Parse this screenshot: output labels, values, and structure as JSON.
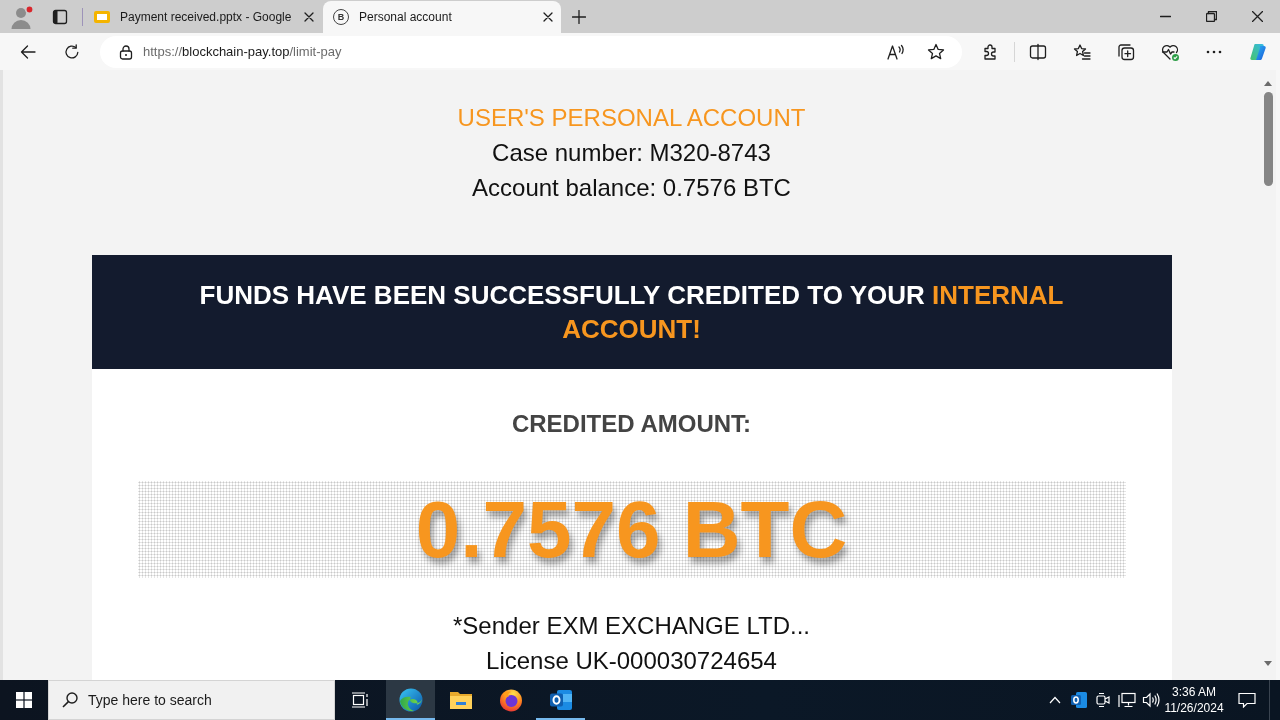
{
  "browser": {
    "tabs": [
      {
        "kind": "slides",
        "title": "Payment received.pptx - Google",
        "selected": false
      },
      {
        "kind": "site",
        "badge": "B",
        "title": "Personal account",
        "selected": true
      }
    ],
    "address": {
      "scheme": "https://",
      "host": "blockchain-pay.top",
      "path": "/limit-pay"
    }
  },
  "page": {
    "heading": "USER'S PERSONAL ACCOUNT",
    "case_number": "Case number: M320-8743",
    "balance": "Account balance: 0.7576 BTC",
    "banner": {
      "text": "FUNDS HAVE BEEN SUCCESSFULLY CREDITED TO YOUR",
      "highlight": "INTERNAL ACCOUNT!"
    },
    "amount_label": "CREDITED AMOUNT:",
    "amount": "0.7576 BTC",
    "sender": "*Sender EXM EXCHANGE LTD...",
    "license": "License UK-000030724654"
  },
  "taskbar": {
    "search": {
      "placeholder": "Type here to search"
    },
    "apps": [
      {
        "kind": "browser",
        "selected": true,
        "running": true
      },
      {
        "kind": "folder",
        "selected": false,
        "running": false
      },
      {
        "kind": "firefox",
        "selected": false,
        "running": false
      },
      {
        "kind": "mail",
        "selected": false,
        "running": true
      }
    ],
    "clock": {
      "time": "3:36 AM",
      "date": "11/26/2024"
    }
  }
}
